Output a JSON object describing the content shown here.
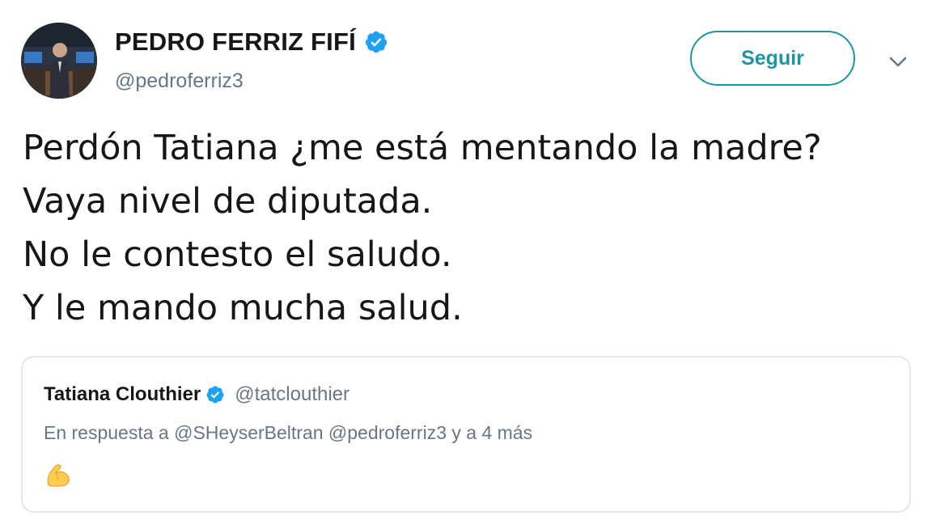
{
  "author": {
    "display_name": "PEDRO FERRIZ FIFÍ",
    "handle": "@pedroferriz3",
    "verified_icon": "verified-badge-icon",
    "avatar_icon": "avatar-photo"
  },
  "follow_button": {
    "label": "Seguir"
  },
  "caret_icon": "chevron-down-icon",
  "tweet": {
    "lines": [
      "Perdón Tatiana ¿me está mentando la madre?",
      "Vaya nivel de diputada.",
      "No le contesto el saludo.",
      "Y le mando mucha salud."
    ]
  },
  "quoted_tweet": {
    "display_name": "Tatiana Clouthier",
    "handle": "@tatclouthier",
    "verified_icon": "verified-badge-icon",
    "reply_context": "En respuesta a @SHeyserBeltran @pedroferriz3 y a 4 más",
    "emoji_icon": "flexed-biceps-icon"
  },
  "colors": {
    "accent": "#1b95a3",
    "verified": "#1da1f2",
    "text": "#14171a",
    "muted": "#657786",
    "border": "#e1e8ed"
  }
}
